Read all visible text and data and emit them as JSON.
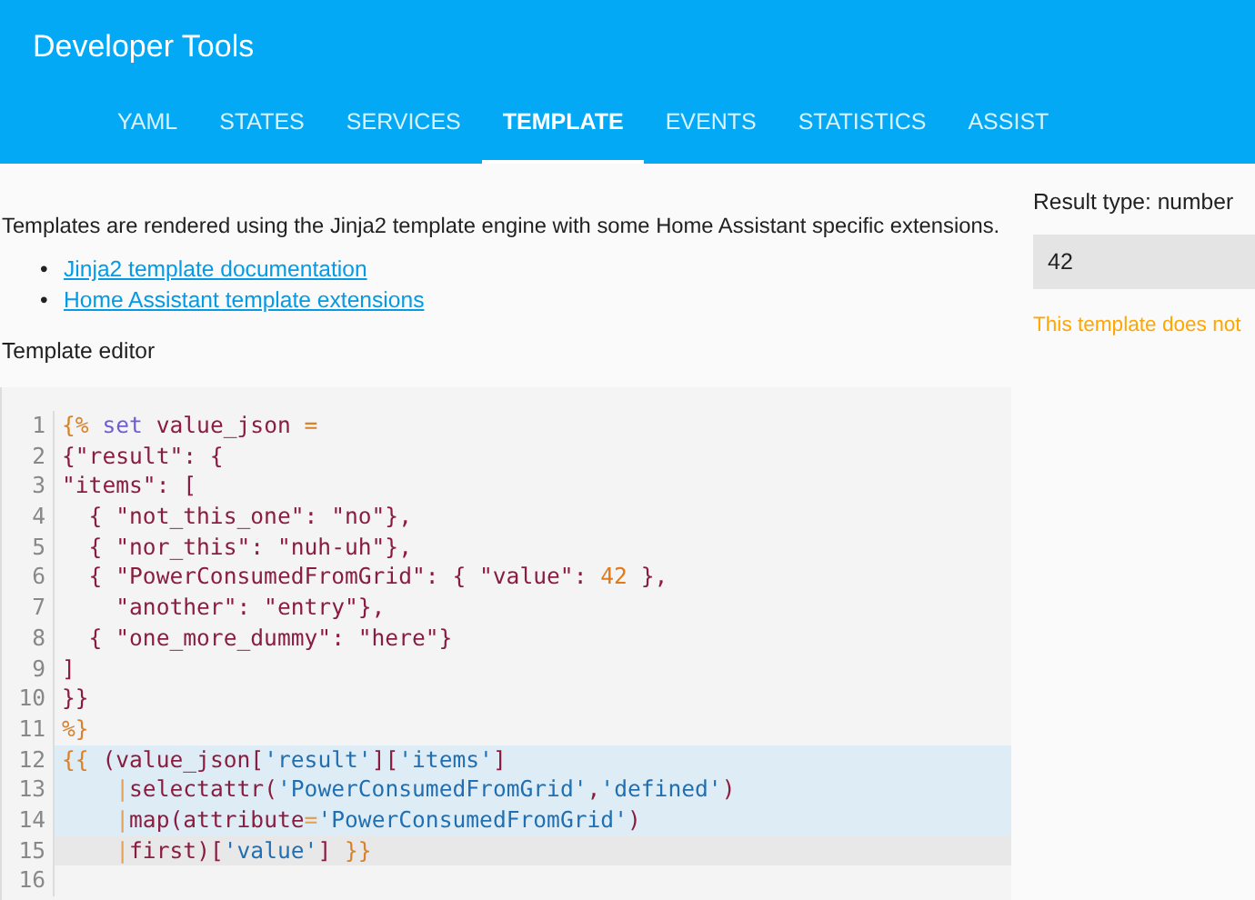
{
  "header": {
    "title": "Developer Tools"
  },
  "tabs": [
    {
      "label": "YAML",
      "selected": false
    },
    {
      "label": "STATES",
      "selected": false
    },
    {
      "label": "SERVICES",
      "selected": false
    },
    {
      "label": "TEMPLATE",
      "selected": true
    },
    {
      "label": "EVENTS",
      "selected": false
    },
    {
      "label": "STATISTICS",
      "selected": false
    },
    {
      "label": "ASSIST",
      "selected": false
    }
  ],
  "intro": "Templates are rendered using the Jinja2 template engine with some Home Assistant specific extensions.",
  "links": [
    {
      "marker": "•",
      "text": "Jinja2 template documentation"
    },
    {
      "marker": "•",
      "text": "Home Assistant template extensions"
    }
  ],
  "editor_label": "Template editor",
  "editor": {
    "lines": [
      {
        "number": "1",
        "selected": false,
        "cursor": false,
        "tokens": [
          {
            "text": "{%",
            "kind": "tag"
          },
          {
            "text": " set",
            "kind": "keyword"
          },
          {
            "text": " value_json",
            "kind": "var"
          },
          {
            "text": " =",
            "kind": "tag"
          }
        ]
      },
      {
        "number": "2",
        "selected": false,
        "cursor": false,
        "tokens": [
          {
            "text": "{\"result\": {",
            "kind": "json"
          }
        ]
      },
      {
        "number": "3",
        "selected": false,
        "cursor": false,
        "tokens": [
          {
            "text": "\"items\": [",
            "kind": "json"
          }
        ]
      },
      {
        "number": "4",
        "selected": false,
        "cursor": false,
        "tokens": [
          {
            "text": "  { \"not_this_one\": \"no\"},",
            "kind": "json"
          }
        ]
      },
      {
        "number": "5",
        "selected": false,
        "cursor": false,
        "tokens": [
          {
            "text": "  { \"nor_this\": \"nuh-uh\"},",
            "kind": "json"
          }
        ]
      },
      {
        "number": "6",
        "selected": false,
        "cursor": false,
        "tokens": [
          {
            "text": "  { \"PowerConsumedFromGrid\": { \"value\": ",
            "kind": "json"
          },
          {
            "text": "42",
            "kind": "number"
          },
          {
            "text": " },",
            "kind": "json"
          }
        ]
      },
      {
        "number": "7",
        "selected": false,
        "cursor": false,
        "tokens": [
          {
            "text": "    \"another\": \"entry\"},",
            "kind": "json"
          }
        ]
      },
      {
        "number": "8",
        "selected": false,
        "cursor": false,
        "tokens": [
          {
            "text": "  { \"one_more_dummy\": \"here\"}",
            "kind": "json"
          }
        ]
      },
      {
        "number": "9",
        "selected": false,
        "cursor": false,
        "tokens": [
          {
            "text": "]",
            "kind": "json"
          }
        ]
      },
      {
        "number": "10",
        "selected": false,
        "cursor": false,
        "tokens": [
          {
            "text": "}}",
            "kind": "json"
          }
        ]
      },
      {
        "number": "11",
        "selected": false,
        "cursor": false,
        "tokens": [
          {
            "text": "%}",
            "kind": "tag"
          }
        ]
      },
      {
        "number": "12",
        "selected": true,
        "cursor": false,
        "tokens": [
          {
            "text": "{{",
            "kind": "tag"
          },
          {
            "text": " (",
            "kind": "punct"
          },
          {
            "text": "value_json",
            "kind": "var"
          },
          {
            "text": "[",
            "kind": "punct"
          },
          {
            "text": "'result'",
            "kind": "string"
          },
          {
            "text": "][",
            "kind": "punct"
          },
          {
            "text": "'items'",
            "kind": "string"
          },
          {
            "text": "]",
            "kind": "punct"
          }
        ]
      },
      {
        "number": "13",
        "selected": true,
        "cursor": false,
        "tokens": [
          {
            "text": "    |",
            "kind": "pipe"
          },
          {
            "text": "selectattr",
            "kind": "func"
          },
          {
            "text": "(",
            "kind": "punct"
          },
          {
            "text": "'PowerConsumedFromGrid'",
            "kind": "string"
          },
          {
            "text": ",",
            "kind": "punct"
          },
          {
            "text": "'defined'",
            "kind": "string"
          },
          {
            "text": ")",
            "kind": "punct"
          }
        ]
      },
      {
        "number": "14",
        "selected": true,
        "cursor": false,
        "tokens": [
          {
            "text": "    |",
            "kind": "pipe"
          },
          {
            "text": "map",
            "kind": "func"
          },
          {
            "text": "(",
            "kind": "punct"
          },
          {
            "text": "attribute",
            "kind": "func"
          },
          {
            "text": "=",
            "kind": "pipe"
          },
          {
            "text": "'PowerConsumedFromGrid'",
            "kind": "string"
          },
          {
            "text": ")",
            "kind": "punct"
          }
        ]
      },
      {
        "number": "15",
        "selected": false,
        "cursor": true,
        "tokens": [
          {
            "text": "    |",
            "kind": "pipe"
          },
          {
            "text": "first",
            "kind": "func"
          },
          {
            "text": ")",
            "kind": "punct"
          },
          {
            "text": "[",
            "kind": "punct"
          },
          {
            "text": "'value'",
            "kind": "string"
          },
          {
            "text": "]",
            "kind": "punct"
          },
          {
            "text": " }}",
            "kind": "tag"
          }
        ]
      },
      {
        "number": "16",
        "selected": false,
        "cursor": false
      }
    ]
  },
  "result": {
    "type_label": "Result type: number",
    "value": "42",
    "warning": "This template does not"
  }
}
